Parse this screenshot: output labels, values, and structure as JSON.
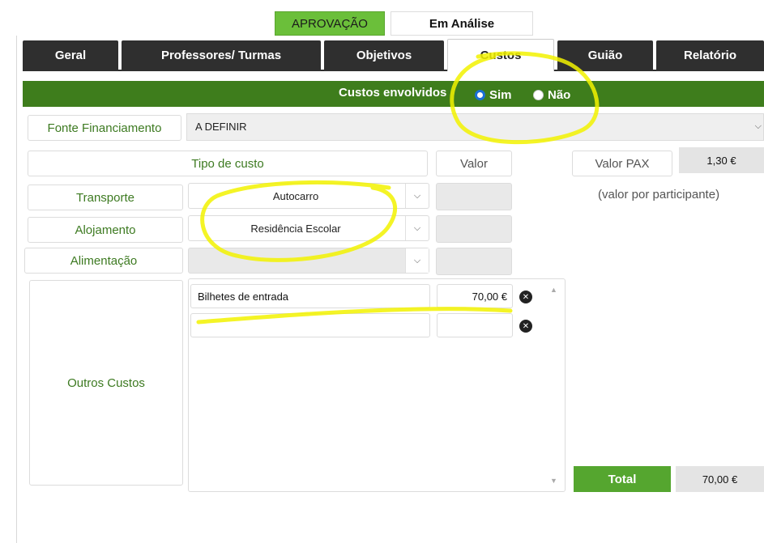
{
  "status": {
    "label": "APROVAÇÃO",
    "value": "Em Análise"
  },
  "tabs": [
    {
      "label": "Geral"
    },
    {
      "label": "Professores/ Turmas"
    },
    {
      "label": "Objetivos"
    },
    {
      "label": "Custos"
    },
    {
      "label": "Guião"
    },
    {
      "label": "Relatório"
    }
  ],
  "costs_bar": {
    "label": "Custos envolvidos",
    "option_yes": "Sim",
    "option_no": "Não",
    "selected": "Sim"
  },
  "fonte": {
    "label": "Fonte Financiamento",
    "value": "A DEFINIR"
  },
  "headers": {
    "tipo_custo": "Tipo de custo",
    "valor": "Valor"
  },
  "rows": {
    "transporte": {
      "label": "Transporte",
      "value": "Autocarro"
    },
    "alojamento": {
      "label": "Alojamento",
      "value": "Residência Escolar"
    },
    "alimentacao": {
      "label": "Alimentação",
      "value": ""
    }
  },
  "outros": {
    "label": "Outros Custos",
    "items": [
      {
        "description": "Bilhetes de entrada",
        "value": "70,00 €"
      },
      {
        "description": "",
        "value": ""
      }
    ]
  },
  "pax": {
    "label": "Valor PAX",
    "value": "1,30 €",
    "note": "(valor por participante)"
  },
  "total": {
    "label": "Total",
    "value": "70,00 €"
  },
  "icons": {
    "delete": "close-icon",
    "dropdown": "chevron-down-icon",
    "scroll_up": "scroll-up-icon",
    "scroll_down": "scroll-down-icon"
  },
  "colors": {
    "green_bar": "#3e7d1c",
    "status_green": "#6bbf3a",
    "tab_dark": "#2f2f2f",
    "total_green": "#55a62f",
    "highlight": "#f2f200"
  }
}
